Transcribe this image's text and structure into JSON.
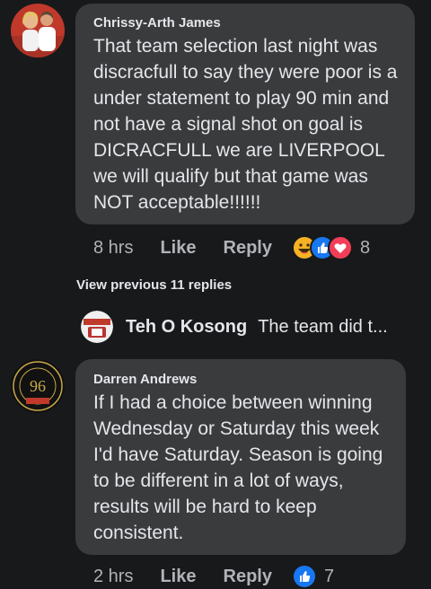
{
  "comments": [
    {
      "author": "Chrissy-Arth James",
      "text": "That team selection last night  was discracfull to say they were poor is a under statement to play 90 min and not have a signal shot on goal is DICRACFULL we are LIVERPOOL we will qualify but that game was NOT acceptable!!!!!!",
      "time": "8 hrs",
      "like_label": "Like",
      "reply_label": "Reply",
      "reactions": [
        "haha-icon",
        "like-icon",
        "love-icon"
      ],
      "reaction_count": "8"
    },
    {
      "author": "Darren Andrews",
      "text": "If I had a choice between winning Wednesday or Saturday this week I'd have Saturday. Season is going to be different in a lot of ways, results will be hard to keep consistent.",
      "time": "2 hrs",
      "like_label": "Like",
      "reply_label": "Reply",
      "reactions": [
        "like-icon"
      ],
      "reaction_count": "7"
    }
  ],
  "view_previous": "View previous 11 replies",
  "reply_preview": {
    "author": "Teh O Kosong",
    "text": "The team did t..."
  },
  "colors": {
    "background": "#18191a",
    "bubble": "#3a3b3c",
    "text": "#e4e6eb",
    "muted": "#b0b3b8",
    "like_blue": "#1877f2",
    "love_red": "#f33e58",
    "haha_yellow": "#f7b125"
  }
}
